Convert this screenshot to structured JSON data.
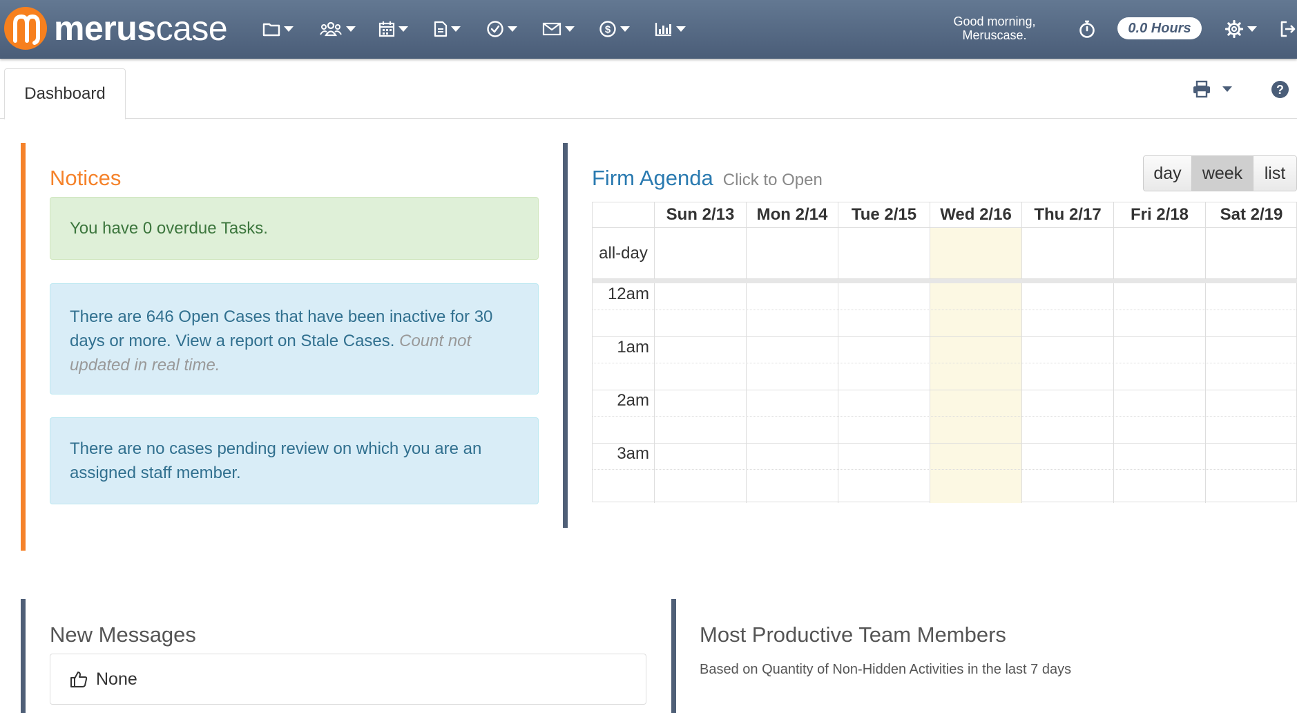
{
  "navbar": {
    "brand_bold": "merus",
    "brand_light": "case",
    "menus": [
      "folder-icon",
      "users-icon",
      "calendar-icon",
      "document-icon",
      "check-circle-icon",
      "envelope-icon",
      "dollar-icon",
      "chart-icon"
    ],
    "greeting_line1": "Good morning,",
    "greeting_line2": "Meruscase.",
    "hours": "0.0 Hours",
    "colors": {
      "nav_top": "#637892",
      "nav_bottom": "#4a5d78",
      "brand_accent": "#f7801e"
    }
  },
  "tabs": {
    "dashboard": "Dashboard"
  },
  "notices": {
    "title": "Notices",
    "overdue": "You have 0 overdue Tasks.",
    "stale_text": "There are 646 Open Cases that have been inactive for 30 days or more. View a report on Stale Cases.",
    "stale_note": "Count not updated in real time.",
    "pending_review": "There are no cases pending review on which you are an assigned staff member.",
    "colors": {
      "accent": "#f5822a",
      "success_bg": "#dff0d8",
      "info_bg": "#d9edf7"
    }
  },
  "agenda": {
    "title": "Firm Agenda",
    "subtitle": "Click to Open",
    "views": [
      "day",
      "week",
      "list"
    ],
    "active_view": "week",
    "days": [
      "Sun 2/13",
      "Mon 2/14",
      "Tue 2/15",
      "Wed 2/16",
      "Thu 2/17",
      "Fri 2/18",
      "Sat 2/19"
    ],
    "today": "Wed 2/16",
    "allday_label": "all-day",
    "hours": [
      "12am",
      "1am",
      "2am",
      "3am"
    ],
    "colors": {
      "title": "#2a7ab0",
      "today_bg": "#fcf8e3"
    }
  },
  "messages": {
    "title": "New Messages",
    "empty_label": "None"
  },
  "productive": {
    "title": "Most Productive Team Members",
    "subtitle": "Based on Quantity of Non-Hidden Activities in the last 7 days"
  }
}
